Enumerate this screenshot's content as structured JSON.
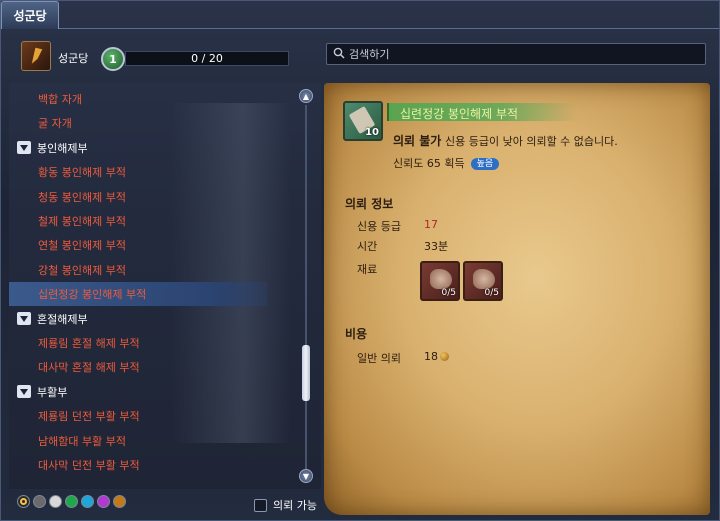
{
  "window": {
    "title": "성군당"
  },
  "header": {
    "guild_name": "성군당",
    "level": "1",
    "progress_text": "0 / 20",
    "progress_fraction": 0.0,
    "search_placeholder": "검색하기"
  },
  "list": [
    {
      "type": "item",
      "label": "백합 자개"
    },
    {
      "type": "item",
      "label": "굴 자개"
    },
    {
      "type": "category",
      "label": "봉인해제부"
    },
    {
      "type": "item",
      "label": "황동 봉인해제 부적"
    },
    {
      "type": "item",
      "label": "청동 봉인해제 부적"
    },
    {
      "type": "item",
      "label": "철제 봉인해제 부적"
    },
    {
      "type": "item",
      "label": "연철 봉인해제 부적"
    },
    {
      "type": "item",
      "label": "강철 봉인해제 부적"
    },
    {
      "type": "item",
      "label": "십련정강 봉인해제 부적",
      "selected": true
    },
    {
      "type": "category",
      "label": "혼절해제부"
    },
    {
      "type": "item",
      "label": "제룡림 혼절 해제 부적"
    },
    {
      "type": "item",
      "label": "대사막 혼절 해제 부적"
    },
    {
      "type": "category",
      "label": "부활부"
    },
    {
      "type": "item",
      "label": "제룡림 던전 부활 부적"
    },
    {
      "type": "item",
      "label": "남해함대 부활 부적"
    },
    {
      "type": "item",
      "label": "대사막 던전 부활 부적"
    }
  ],
  "filters": {
    "color_dots": [
      "#2a2a2a",
      "#6a6a6a",
      "#d8d8d8",
      "#1fa84a",
      "#1ea6d8",
      "#b03ad0",
      "#c07a1a"
    ],
    "available_label": "의뢰 가능"
  },
  "detail": {
    "item_title": "십련정강 봉인해제 부적",
    "item_count": "10",
    "status_label": "의뢰 불가",
    "status_reason": "신용 등급이 낮아 의뢰할 수 없습니다.",
    "trust_text": "신뢰도 65 획득",
    "trust_badge": "높음",
    "info_heading": "의뢰 정보",
    "credit_label": "신용 등급",
    "credit_value": "17",
    "time_label": "시간",
    "time_value": "33분",
    "material_label": "재료",
    "materials": [
      {
        "count": "0/5",
        "icon": "material-icon"
      },
      {
        "count": "0/5",
        "icon": "material-icon"
      }
    ],
    "cost_heading": "비용",
    "cost_label": "일반 의뢰",
    "cost_value": "18"
  }
}
